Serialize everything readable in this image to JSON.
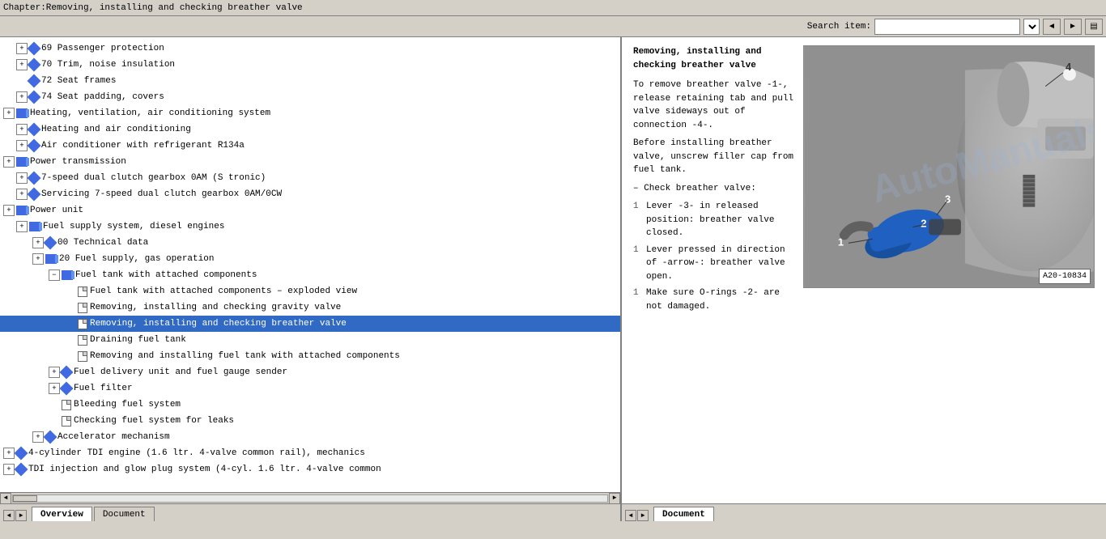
{
  "title_bar": {
    "text": "Chapter:Removing, installing and checking breather valve"
  },
  "toolbar": {
    "search_label": "Search item:",
    "search_placeholder": ""
  },
  "tree": {
    "items": [
      {
        "id": "t1",
        "indent": 1,
        "type": "expand",
        "icon": "diamond",
        "text": "69 Passenger protection",
        "selected": false
      },
      {
        "id": "t2",
        "indent": 1,
        "type": "expand",
        "icon": "diamond",
        "text": "70 Trim, noise insulation",
        "selected": false
      },
      {
        "id": "t3",
        "indent": 1,
        "type": "none",
        "icon": "diamond",
        "text": "72 Seat frames",
        "selected": false
      },
      {
        "id": "t4",
        "indent": 1,
        "type": "expand",
        "icon": "diamond",
        "text": "74 Seat padding, covers",
        "selected": false
      },
      {
        "id": "t5",
        "indent": 0,
        "type": "expand",
        "icon": "book",
        "text": "Heating, ventilation, air conditioning system",
        "selected": false
      },
      {
        "id": "t6",
        "indent": 1,
        "type": "expand",
        "icon": "diamond",
        "text": "Heating and air conditioning",
        "selected": false
      },
      {
        "id": "t7",
        "indent": 1,
        "type": "expand",
        "icon": "diamond",
        "text": "Air conditioner with refrigerant R134a",
        "selected": false
      },
      {
        "id": "t8",
        "indent": 0,
        "type": "expand",
        "icon": "book",
        "text": "Power transmission",
        "selected": false
      },
      {
        "id": "t9",
        "indent": 1,
        "type": "expand",
        "icon": "diamond",
        "text": "7-speed dual clutch gearbox 0AM (S tronic)",
        "selected": false
      },
      {
        "id": "t10",
        "indent": 1,
        "type": "expand",
        "icon": "diamond",
        "text": "Servicing 7-speed dual clutch gearbox 0AM/0CW",
        "selected": false
      },
      {
        "id": "t11",
        "indent": 0,
        "type": "expand",
        "icon": "book",
        "text": "Power unit",
        "selected": false
      },
      {
        "id": "t12",
        "indent": 1,
        "type": "expand",
        "icon": "book",
        "text": "Fuel supply system, diesel engines",
        "selected": false
      },
      {
        "id": "t13",
        "indent": 2,
        "type": "expand",
        "icon": "diamond",
        "text": "00 Technical data",
        "selected": false
      },
      {
        "id": "t14",
        "indent": 2,
        "type": "expand",
        "icon": "book",
        "text": "20 Fuel supply, gas operation",
        "selected": false
      },
      {
        "id": "t15",
        "indent": 3,
        "type": "expand",
        "icon": "book",
        "text": "Fuel tank with attached components",
        "selected": false
      },
      {
        "id": "t16",
        "indent": 4,
        "type": "none",
        "icon": "page",
        "text": "Fuel tank with attached components – exploded view",
        "selected": false
      },
      {
        "id": "t17",
        "indent": 4,
        "type": "none",
        "icon": "page",
        "text": "Removing, installing and checking gravity valve",
        "selected": false
      },
      {
        "id": "t18",
        "indent": 4,
        "type": "none",
        "icon": "page",
        "text": "Removing, installing and checking breather valve",
        "selected": true
      },
      {
        "id": "t19",
        "indent": 4,
        "type": "none",
        "icon": "page",
        "text": "Draining fuel tank",
        "selected": false
      },
      {
        "id": "t20",
        "indent": 4,
        "type": "none",
        "icon": "page",
        "text": "Removing and installing fuel tank with attached components",
        "selected": false
      },
      {
        "id": "t21",
        "indent": 3,
        "type": "expand",
        "icon": "diamond",
        "text": "Fuel delivery unit and fuel gauge sender",
        "selected": false
      },
      {
        "id": "t22",
        "indent": 3,
        "type": "expand",
        "icon": "diamond",
        "text": "Fuel filter",
        "selected": false
      },
      {
        "id": "t23",
        "indent": 3,
        "type": "none",
        "icon": "page",
        "text": "Bleeding fuel system",
        "selected": false
      },
      {
        "id": "t24",
        "indent": 3,
        "type": "none",
        "icon": "page",
        "text": "Checking fuel system for leaks",
        "selected": false
      },
      {
        "id": "t25",
        "indent": 2,
        "type": "expand",
        "icon": "diamond",
        "text": "Accelerator mechanism",
        "selected": false
      },
      {
        "id": "t26",
        "indent": 0,
        "type": "expand",
        "icon": "diamond",
        "text": "4-cylinder TDI engine (1.6 ltr. 4-valve common rail), mechanics",
        "selected": false
      },
      {
        "id": "t27",
        "indent": 0,
        "type": "expand",
        "icon": "diamond",
        "text": "TDI injection and glow plug system (4-cyl. 1.6 ltr. 4-valve common",
        "selected": false
      }
    ]
  },
  "bottom_tabs_left": {
    "overview": "Overview",
    "document": "Document"
  },
  "document": {
    "title": "Removing, installing and checking breather valve",
    "para1": "To remove breather valve -1-, release retaining tab and pull valve sideways out of connection -4-.",
    "para2": "Before installing breather valve, unscrew filler cap from fuel tank.",
    "check_label": "– Check breather valve:",
    "items": [
      {
        "num": "1",
        "text": "Lever -3- in released position: breather valve closed."
      },
      {
        "num": "1",
        "text": "Lever pressed in direction of -arrow-: breather valve open."
      },
      {
        "num": "1",
        "text": "Make sure O-rings -2- are not damaged."
      }
    ],
    "image_label": "A20-10834",
    "image_numbers": [
      "1",
      "2",
      "3",
      "4"
    ],
    "lever_text": "Lever -3- in released"
  },
  "bottom_tabs_right": {
    "document": "Document"
  },
  "icons": {
    "expand": "+",
    "collapse": "–",
    "prev": "◄",
    "next": "►",
    "left_arrow": "◄",
    "right_arrow": "►"
  }
}
